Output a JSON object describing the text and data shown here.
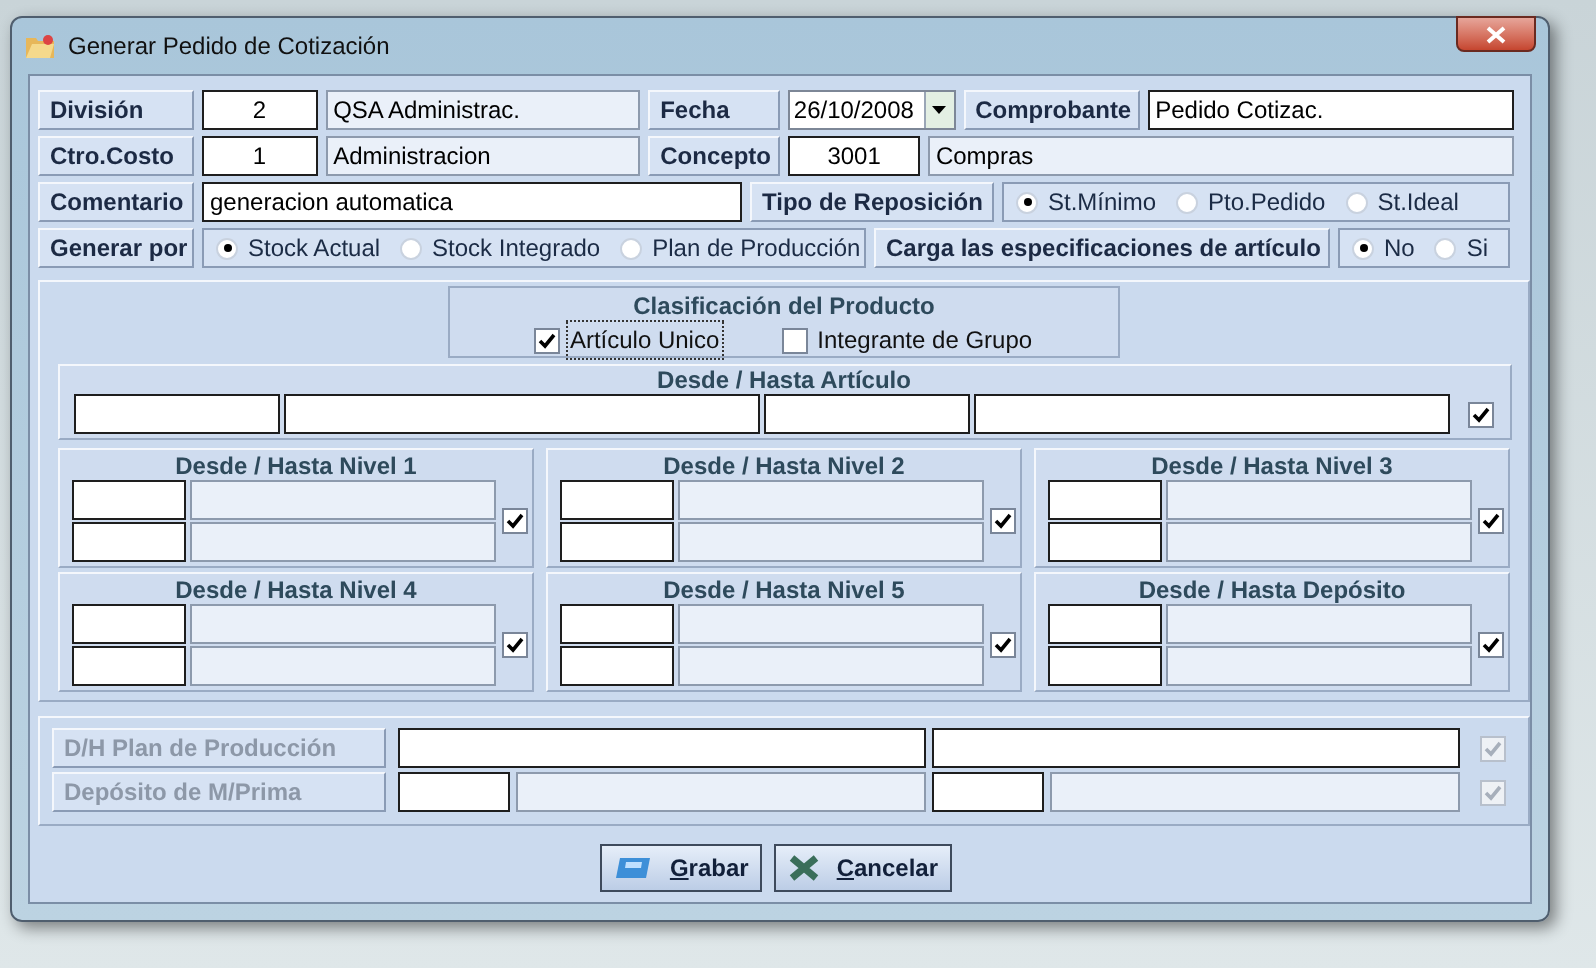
{
  "window": {
    "title": "Generar Pedido de Cotización"
  },
  "header": {
    "division": {
      "label": "División",
      "code": "2",
      "name": "QSA Administrac."
    },
    "fecha": {
      "label": "Fecha",
      "value": "26/10/2008"
    },
    "comprobante": {
      "label": "Comprobante",
      "value": "Pedido Cotizac."
    },
    "ctro_costo": {
      "label": "Ctro.Costo",
      "code": "1",
      "name": "Administracion"
    },
    "concepto": {
      "label": "Concepto",
      "code": "3001",
      "name": "Compras"
    },
    "comentario": {
      "label": "Comentario",
      "value": "generacion automatica"
    },
    "tipo_reposicion": {
      "label": "Tipo de Reposición",
      "options": [
        {
          "label": "St.Mínimo",
          "selected": true
        },
        {
          "label": "Pto.Pedido",
          "selected": false
        },
        {
          "label": "St.Ideal",
          "selected": false
        }
      ]
    },
    "generar_por": {
      "label": "Generar por",
      "options": [
        {
          "label": "Stock Actual",
          "selected": true
        },
        {
          "label": "Stock Integrado",
          "selected": false
        },
        {
          "label": "Plan de Producción",
          "selected": false
        }
      ]
    },
    "carga_especificaciones": {
      "label": "Carga las especificaciones de artículo",
      "options": [
        {
          "label": "No",
          "selected": true
        },
        {
          "label": "Si",
          "selected": false
        }
      ]
    }
  },
  "clasificacion": {
    "title": "Clasificación del Producto",
    "options": [
      {
        "label": "Artículo Unico",
        "checked": true,
        "focused": true
      },
      {
        "label": "Integrante de Grupo",
        "checked": false,
        "focused": false
      }
    ]
  },
  "articulo_range": {
    "title": "Desde / Hasta Artículo",
    "checked": true
  },
  "level_ranges": [
    {
      "title": "Desde / Hasta Nivel 1",
      "checked": true
    },
    {
      "title": "Desde / Hasta Nivel 2",
      "checked": true
    },
    {
      "title": "Desde / Hasta Nivel 3",
      "checked": true
    },
    {
      "title": "Desde / Hasta Nivel 4",
      "checked": true
    },
    {
      "title": "Desde / Hasta Nivel 5",
      "checked": true
    },
    {
      "title": "Desde / Hasta Depósito",
      "checked": true
    }
  ],
  "production": [
    {
      "kind": "wide",
      "label": "D/H Plan de Producción",
      "disabled": true,
      "checked": true
    },
    {
      "kind": "coded",
      "label": "Depósito de M/Prima",
      "disabled": true,
      "checked": true
    }
  ],
  "buttons": [
    {
      "kind": "save",
      "label": "Grabar",
      "first_letter_underlined": true
    },
    {
      "kind": "cancel",
      "label": "Cancelar",
      "first_letter_underlined": true
    }
  ]
}
